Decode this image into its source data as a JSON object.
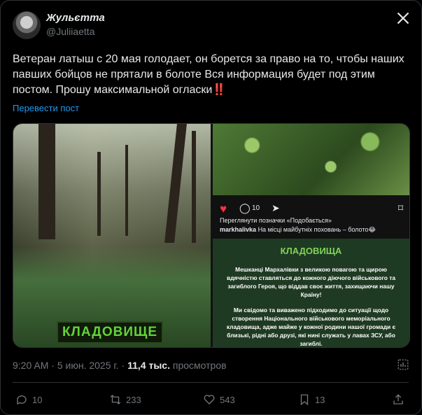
{
  "author": {
    "name": "Жульєтта",
    "handle": "@Juliiaetta"
  },
  "post": {
    "text": "Ветеран латыш с 20 мая голодает, он борется за право на то, чтобы наших павших бойцов не прятали в болоте Вся информация будет под этим постом. Прошу максимальной огласки‼️",
    "translate_label": "Перевести пост"
  },
  "media": {
    "left_label": "КЛАДОВИЩЕ",
    "instagram": {
      "comments": "10",
      "likes_text": "Переглянути позначки «Подобається»",
      "caption_user": "markhalivka",
      "caption_text": "На місці майбутніх поховань – болото😂"
    },
    "notice": {
      "title": "КЛАДОВИЩА",
      "para1": "Мешканці Мархалівки з великою повагою та щирою вдячністю ставляться до кожного діючого військового та загиблого Героя, що віддав своє життя, захищаючи нашу Країну!",
      "para2": "Ми свідомо та виважено підходимо до ситуації щодо створення Національного військового меморіального кладовища, адже майже у кожної родини нашої громади є близькі, рідні або друзі, які нині служать у лавах ЗСУ, або загиблі."
    }
  },
  "meta": {
    "time": "9:20 AM",
    "date": "5 июн. 2025 г.",
    "views": "11,4 тыс.",
    "views_label": "просмотров"
  },
  "actions": {
    "replies": "10",
    "reposts": "233",
    "likes": "543",
    "bookmarks": "13"
  },
  "icons": [
    "x-logo-icon",
    "heart-icon",
    "comment-icon",
    "send-icon",
    "bookmark-icon",
    "analytics-icon",
    "reply-icon",
    "repost-icon",
    "like-icon",
    "share-icon"
  ]
}
